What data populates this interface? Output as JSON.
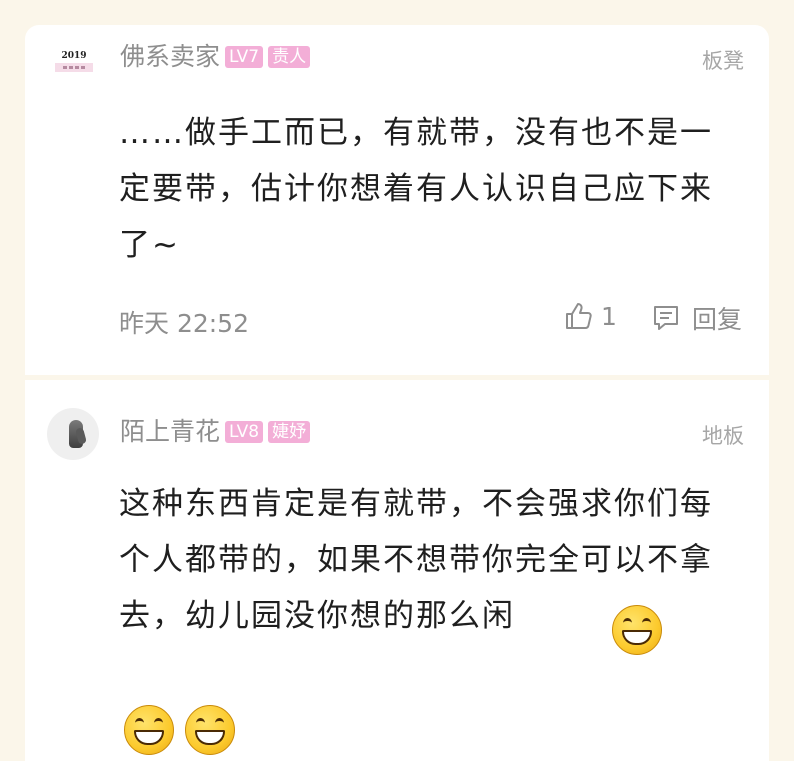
{
  "comments": [
    {
      "username": "佛系卖家",
      "level": "LV7",
      "title": "责人",
      "floor": "板凳",
      "text": "……做手工而已，有就带，没有也不是一定要带，估计你想着有人认识自己应下来了~",
      "time": "昨天 22:52",
      "likes": "1",
      "reply_label": "回复",
      "avatar_text": "2019"
    },
    {
      "username": "陌上青花",
      "level": "LV8",
      "title": "婕妤",
      "floor": "地板",
      "text": "这种东西肯定是有就带，不会强求你们每个人都带的，如果不想带你完全可以不拿去，幼儿园没你想的那么闲"
    }
  ],
  "icons": {
    "like": "thumbs-up-icon",
    "reply": "comment-icon",
    "emoji": "grinning-face-emoji"
  },
  "colors": {
    "background": "#fbf6ea",
    "badge": "#f3aed7",
    "meta_text": "#8e8e8e",
    "body_text": "#1f1f1f"
  }
}
